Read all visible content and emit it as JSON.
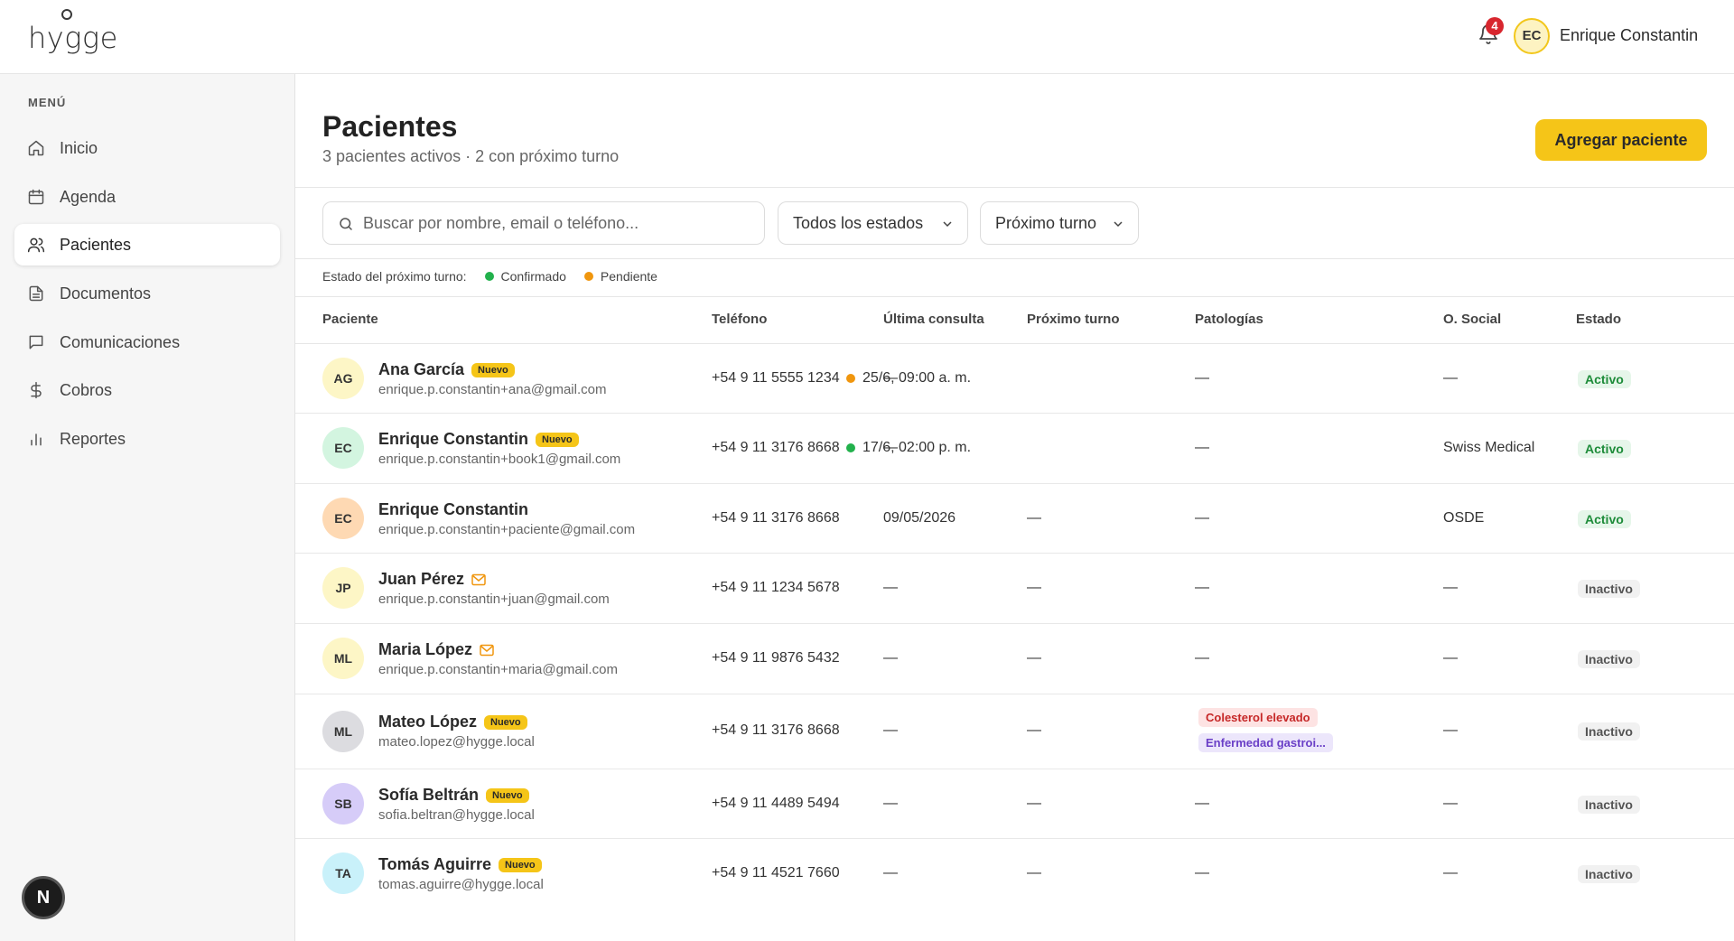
{
  "header": {
    "logo_text": "hygge",
    "notification_count": "4",
    "user_initials": "EC",
    "user_name": "Enrique Constantin"
  },
  "sidebar": {
    "menu_title": "MENÚ",
    "items": [
      {
        "label": "Inicio",
        "icon": "home-icon"
      },
      {
        "label": "Agenda",
        "icon": "calendar-icon"
      },
      {
        "label": "Pacientes",
        "icon": "users-icon",
        "active": true
      },
      {
        "label": "Documentos",
        "icon": "document-icon"
      },
      {
        "label": "Comunicaciones",
        "icon": "chat-icon"
      },
      {
        "label": "Cobros",
        "icon": "dollar-icon"
      },
      {
        "label": "Reportes",
        "icon": "bar-chart-icon"
      }
    ],
    "next_badge": "N"
  },
  "page": {
    "title": "Pacientes",
    "subtitle": "3 pacientes activos · 2 con próximo turno",
    "add_button": "Agregar paciente"
  },
  "filters": {
    "search_placeholder": "Buscar por nombre, email o teléfono...",
    "status_select": "Todos los estados",
    "sort_select": "Próximo turno"
  },
  "legend": {
    "label": "Estado del próximo turno:",
    "confirmed": "Confirmado",
    "pending": "Pendiente"
  },
  "colors": {
    "accent": "#f5c518",
    "confirmed": "#22b14c",
    "pending": "#f0960e"
  },
  "table": {
    "headers": {
      "patient": "Paciente",
      "phone": "Teléfono",
      "last_visit": "Última consulta",
      "next_appt": "Próximo turno",
      "pathologies": "Patologías",
      "insurance": "O. Social",
      "status": "Estado"
    },
    "new_badge": "Nuevo",
    "rows": [
      {
        "initials": "AG",
        "name": "Ana García",
        "email": "enrique.p.constantin+ana@gmail.com",
        "phone": "+54 9 11 5555 1234",
        "last_visit": "—",
        "next_appt": "25/6, 09:00 a. m.",
        "pathologies": "—",
        "insurance": "—",
        "status": "Activo"
      },
      {
        "initials": "EC",
        "name": "Enrique Constantin",
        "email": "enrique.p.constantin+book1@gmail.com",
        "phone": "+54 9 11 3176 8668",
        "last_visit": "—",
        "next_appt": "17/6, 02:00 p. m.",
        "pathologies": "—",
        "insurance": "Swiss Medical",
        "status": "Activo"
      },
      {
        "initials": "EC",
        "name": "Enrique Constantin",
        "email": "enrique.p.constantin+paciente@gmail.com",
        "phone": "+54 9 11 3176 8668",
        "last_visit": "09/05/2026",
        "next_appt": "—",
        "pathologies": "—",
        "insurance": "OSDE",
        "status": "Activo"
      },
      {
        "initials": "JP",
        "name": "Juan Pérez",
        "email": "enrique.p.constantin+juan@gmail.com",
        "phone": "+54 9 11 1234 5678",
        "last_visit": "—",
        "next_appt": "—",
        "pathologies": "—",
        "insurance": "—",
        "status": "Inactivo"
      },
      {
        "initials": "ML",
        "name": "Maria López",
        "email": "enrique.p.constantin+maria@gmail.com",
        "phone": "+54 9 11 9876 5432",
        "last_visit": "—",
        "next_appt": "—",
        "pathologies": "—",
        "insurance": "—",
        "status": "Inactivo"
      },
      {
        "initials": "ML",
        "name": "Mateo López",
        "email": "mateo.lopez@hygge.local",
        "phone": "+54 9 11 3176 8668",
        "last_visit": "—",
        "next_appt": "—",
        "tag1": "Colesterol elevado",
        "tag2": "Enfermedad gastroi...",
        "insurance": "—",
        "status": "Inactivo"
      },
      {
        "initials": "SB",
        "name": "Sofía Beltrán",
        "email": "sofia.beltran@hygge.local",
        "phone": "+54 9 11 4489 5494",
        "last_visit": "—",
        "next_appt": "—",
        "pathologies": "—",
        "insurance": "—",
        "status": "Inactivo"
      },
      {
        "initials": "TA",
        "name": "Tomás Aguirre",
        "email": "tomas.aguirre@hygge.local",
        "phone": "+54 9 11 4521 7660",
        "last_visit": "—",
        "next_appt": "—",
        "pathologies": "—",
        "insurance": "—",
        "status": "Inactivo"
      }
    ]
  }
}
